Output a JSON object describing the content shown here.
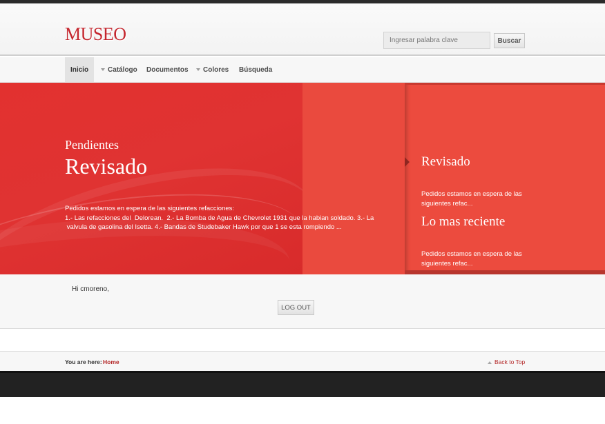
{
  "header": {
    "logo": "MUSEO",
    "search": {
      "placeholder": "Ingresar palabra clave",
      "button_label": "Buscar"
    }
  },
  "nav": {
    "items": [
      {
        "label": "Inicio",
        "active": true,
        "has_dropdown": false
      },
      {
        "label": "Catálogo",
        "active": false,
        "has_dropdown": true
      },
      {
        "label": "Documentos",
        "active": false,
        "has_dropdown": false
      },
      {
        "label": "Colores",
        "active": false,
        "has_dropdown": true
      },
      {
        "label": "Búsqueda",
        "active": false,
        "has_dropdown": false
      }
    ]
  },
  "hero": {
    "kicker": "Pendientes",
    "title": "Revisado",
    "text_lines": [
      "Pedidos estamos en espera de las siguientes refacciones:",
      "1.- Las refacciones del  Delorean.  2.- La Bomba de Agua de Chevrolet 1931 que la habian soldado. 3.- La",
      " valvula de gasolina del Isetta. 4.- Bandas de Studebaker Hawk por que 1 se esta rompiendo ..."
    ],
    "side_items": [
      {
        "title": "Revisado",
        "text": "Pedidos estamos en espera de las siguientes refac..."
      },
      {
        "title": "Lo mas reciente",
        "text": "Pedidos estamos en espera de las siguientes refac..."
      }
    ]
  },
  "user": {
    "greeting": "Hi cmoreno,",
    "logout_label": "LOG OUT"
  },
  "breadcrumb": {
    "label": "You are here:",
    "current": "Home",
    "back_to_top": "Back to Top"
  },
  "colors": {
    "accent": "#c4262e",
    "hero_red": "#e2312f",
    "panel_red": "#ec4b3e",
    "dark_footer": "#222222"
  }
}
